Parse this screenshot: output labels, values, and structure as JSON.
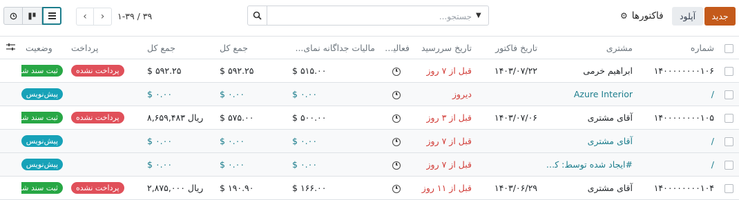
{
  "toolbar": {
    "new_label": "جدید",
    "upload_label": "آپلود",
    "title": "فاکتورها",
    "search_placeholder": "جستجو...",
    "pager_value": "۱-۳۹ / ۳۹"
  },
  "icons": {
    "gear": "gear-icon",
    "search": "search-icon",
    "caret": "caret-down-icon",
    "prev": "chevron-left-icon",
    "next": "chevron-right-icon",
    "view_list": "list-view-icon",
    "view_kanban": "kanban-view-icon",
    "view_activity": "activity-view-icon",
    "settings": "optional-columns-icon",
    "activity": "clock-icon"
  },
  "colors": {
    "primary": "#c45a1b",
    "teal": "#1c7d8c",
    "overdue": "#d23f3a",
    "posted": "#28a745",
    "not_paid": "#e0505a",
    "draft": "#17a2b8"
  },
  "table": {
    "headers": {
      "number": "شماره",
      "customer": "مشتری",
      "invoice_date": "تاریخ فاکتور",
      "due_date": "تاریخ سررسید",
      "activities": "فعالیت‌ها",
      "tax": "مالیات جداگانه نمای...",
      "total": "جمع کل",
      "total_signed": "جمع کل",
      "payment": "پرداخت",
      "status": "وضعیت"
    },
    "rows": [
      {
        "number": "۱۴۰۰۰۰۰۰۰۰۱۰۶",
        "customer": "ابراهیم خرمی",
        "invoice_date": "۱۴۰۳/۰۷/۲۲",
        "due_date": "قبل از ۷ روز",
        "tax": "۵۱۵.۰۰ $",
        "total": "۵۹۲.۲۵ $",
        "total_signed": "۵۹۲.۲۵ $",
        "payment": "پرداخت نشده",
        "status": "ثبت سند شده"
      },
      {
        "number": "/",
        "customer": "Azure Interior",
        "invoice_date": "",
        "due_date": "دیروز",
        "tax": "۰.۰۰ $",
        "total": "۰.۰۰ $",
        "total_signed": "۰.۰۰ $",
        "payment": "",
        "status": "پیش‌نویس"
      },
      {
        "number": "۱۴۰۰۰۰۰۰۰۰۱۰۵",
        "customer": "آقای مشتری",
        "invoice_date": "۱۴۰۳/۰۷/۰۶",
        "due_date": "قبل از ۳ روز",
        "tax": "۵۰۰.۰۰ $",
        "total": "۵۷۵.۰۰ $",
        "total_signed": "ریال ۸,۶۵۹,۴۸۳",
        "payment": "پرداخت نشده",
        "status": "ثبت سند شده"
      },
      {
        "number": "/",
        "customer": "آقای مشتری",
        "invoice_date": "",
        "due_date": "قبل از ۷ روز",
        "tax": "۰.۰۰ $",
        "total": "۰.۰۰ $",
        "total_signed": "۰.۰۰ $",
        "payment": "",
        "status": "پیش‌نویس"
      },
      {
        "number": "/",
        "customer": "#ایجاد شده توسط: کارب...",
        "invoice_date": "",
        "due_date": "قبل از ۷ روز",
        "tax": "۰.۰۰ $",
        "total": "۰.۰۰ $",
        "total_signed": "۰.۰۰ $",
        "payment": "",
        "status": "پیش‌نویس"
      },
      {
        "number": "۱۴۰۰۰۰۰۰۰۰۱۰۴",
        "customer": "آقای مشتری",
        "invoice_date": "۱۴۰۳/۰۶/۲۹",
        "due_date": "قبل از ۱۱ روز",
        "tax": "۱۶۶.۰۰ $",
        "total": "۱۹۰.۹۰ $",
        "total_signed": "ریال ۲,۸۷۵,۰۰۰",
        "payment": "پرداخت نشده",
        "status": "ثبت سند شده"
      }
    ]
  }
}
